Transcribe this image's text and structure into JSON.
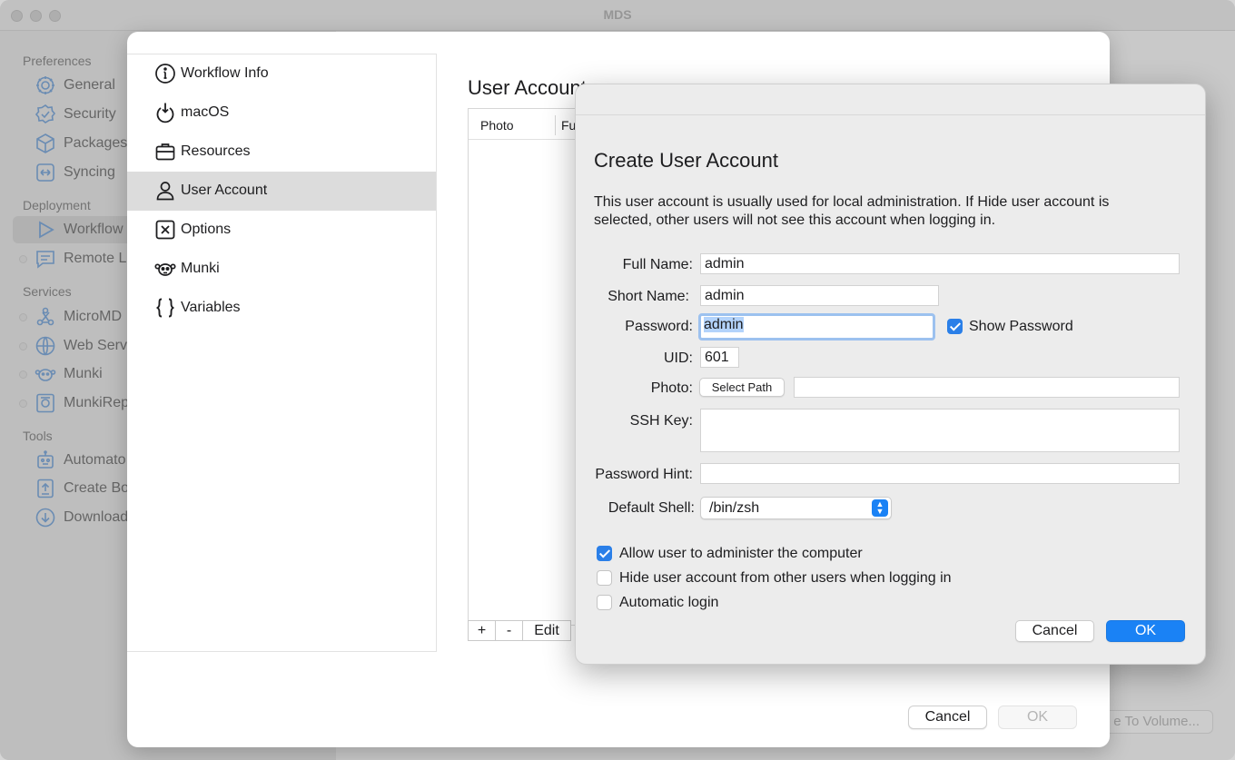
{
  "window": {
    "title": "MDS"
  },
  "sidebar": {
    "sections": [
      {
        "label": "Preferences",
        "items": [
          {
            "label": "General",
            "icon": "gear-icon"
          },
          {
            "label": "Security",
            "icon": "shield-check-icon"
          },
          {
            "label": "Packages",
            "icon": "package-box-icon"
          },
          {
            "label": "Syncing",
            "icon": "sync-arrows-icon"
          }
        ]
      },
      {
        "label": "Deployment",
        "items": [
          {
            "label": "Workflow",
            "icon": "play-icon",
            "selected": true
          },
          {
            "label": "Remote L",
            "icon": "message-icon"
          }
        ]
      },
      {
        "label": "Services",
        "items": [
          {
            "label": "MicroMD",
            "icon": "network-icon"
          },
          {
            "label": "Web Serv",
            "icon": "globe-icon"
          },
          {
            "label": "Munki",
            "icon": "munki-icon"
          },
          {
            "label": "MunkiRep",
            "icon": "munkireport-icon"
          }
        ]
      },
      {
        "label": "Tools",
        "items": [
          {
            "label": "Automato",
            "icon": "robot-icon"
          },
          {
            "label": "Create Bo",
            "icon": "upload-doc-icon"
          },
          {
            "label": "Download",
            "icon": "download-circle-icon"
          }
        ]
      }
    ]
  },
  "background": {
    "write_volume_button": "e To Volume..."
  },
  "workflow": {
    "nav": [
      {
        "label": "Workflow Info",
        "icon": "info-circle-icon"
      },
      {
        "label": "macOS",
        "icon": "macos-download-icon"
      },
      {
        "label": "Resources",
        "icon": "briefcase-icon"
      },
      {
        "label": "User Account",
        "icon": "person-icon",
        "selected": true
      },
      {
        "label": "Options",
        "icon": "x-square-icon"
      },
      {
        "label": "Munki",
        "icon": "munki-icon"
      },
      {
        "label": "Variables",
        "icon": "braces-icon"
      }
    ],
    "section_title": "User Account",
    "table": {
      "columns": [
        "Photo",
        "Full Name"
      ]
    },
    "table_buttons": {
      "add": "+",
      "remove": "-",
      "edit": "Edit"
    },
    "cancel_label": "Cancel",
    "ok_label": "OK"
  },
  "dialog": {
    "title": "Create User Account",
    "description": "This user account is usually used for local administration. If Hide user account is selected, other users will not see this account when logging in.",
    "fields": {
      "full_name": {
        "label": "Full Name:",
        "value": "admin"
      },
      "short_name": {
        "label": "Short Name:",
        "value": "admin"
      },
      "password": {
        "label": "Password:",
        "value": "admin"
      },
      "show_password": {
        "label": "Show Password",
        "checked": true
      },
      "uid": {
        "label": "UID:",
        "value": "601"
      },
      "photo": {
        "label": "Photo:",
        "button": "Select Path",
        "value": ""
      },
      "ssh_key": {
        "label": "SSH Key:",
        "value": ""
      },
      "password_hint": {
        "label": "Password Hint:",
        "value": ""
      },
      "default_shell": {
        "label": "Default Shell:",
        "value": "/bin/zsh"
      }
    },
    "options": [
      {
        "label": "Allow user to administer the computer",
        "checked": true
      },
      {
        "label": "Hide user account from other users when logging in",
        "checked": false
      },
      {
        "label": "Automatic login",
        "checked": false
      }
    ],
    "cancel_label": "Cancel",
    "ok_label": "OK"
  },
  "colors": {
    "accent": "#1a82f5",
    "selection": "#b3d3fb"
  }
}
